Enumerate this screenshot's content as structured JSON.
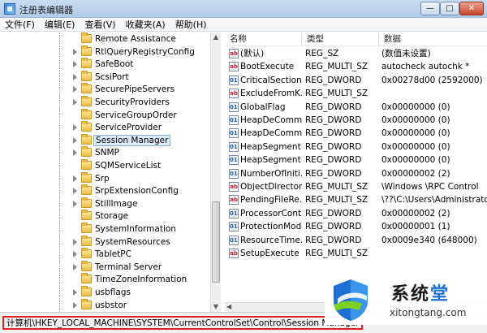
{
  "window": {
    "title": "注册表编辑器",
    "min_label": "—",
    "max_label": "□",
    "close_label": "✕"
  },
  "menu": [
    "文件(F)",
    "编辑(E)",
    "查看(V)",
    "收藏夹(A)",
    "帮助(H)"
  ],
  "tree": {
    "items": [
      {
        "label": "Remote Assistance",
        "expanded_arrow": false
      },
      {
        "label": "RtlQueryRegistryConfig",
        "expanded_arrow": true
      },
      {
        "label": "SafeBoot",
        "expanded_arrow": true
      },
      {
        "label": "ScsiPort",
        "expanded_arrow": true
      },
      {
        "label": "SecurePipeServers",
        "expanded_arrow": true
      },
      {
        "label": "SecurityProviders",
        "expanded_arrow": true
      },
      {
        "label": "ServiceGroupOrder",
        "expanded_arrow": false
      },
      {
        "label": "ServiceProvider",
        "expanded_arrow": true
      },
      {
        "label": "Session Manager",
        "expanded_arrow": true,
        "selected": true
      },
      {
        "label": "SNMP",
        "expanded_arrow": true
      },
      {
        "label": "SQMServiceList",
        "expanded_arrow": false
      },
      {
        "label": "Srp",
        "expanded_arrow": true
      },
      {
        "label": "SrpExtensionConfig",
        "expanded_arrow": true
      },
      {
        "label": "StillImage",
        "expanded_arrow": true
      },
      {
        "label": "Storage",
        "expanded_arrow": false
      },
      {
        "label": "SystemInformation",
        "expanded_arrow": false
      },
      {
        "label": "SystemResources",
        "expanded_arrow": true
      },
      {
        "label": "TabletPC",
        "expanded_arrow": true
      },
      {
        "label": "Terminal Server",
        "expanded_arrow": true
      },
      {
        "label": "TimeZoneInformation",
        "expanded_arrow": false
      },
      {
        "label": "usbflags",
        "expanded_arrow": true
      },
      {
        "label": "usbstor",
        "expanded_arrow": true
      }
    ]
  },
  "values": {
    "headers": {
      "name": "名称",
      "type": "类型",
      "data": "数据"
    },
    "rows": [
      {
        "icon": "string-value-icon",
        "icon_glyph": "ab",
        "name": "(默认)",
        "type": "REG_SZ",
        "data": "(数值未设置)"
      },
      {
        "icon": "string-value-icon",
        "icon_glyph": "ab",
        "name": "BootExecute",
        "type": "REG_MULTI_SZ",
        "data": "autocheck autochk *"
      },
      {
        "icon": "binary-value-icon",
        "icon_glyph": "011",
        "name": "CriticalSection...",
        "type": "REG_DWORD",
        "data": "0x00278d00 (2592000)"
      },
      {
        "icon": "string-value-icon",
        "icon_glyph": "ab",
        "name": "ExcludeFromK...",
        "type": "REG_MULTI_SZ",
        "data": ""
      },
      {
        "icon": "binary-value-icon",
        "icon_glyph": "011",
        "name": "GlobalFlag",
        "type": "REG_DWORD",
        "data": "0x00000000 (0)"
      },
      {
        "icon": "binary-value-icon",
        "icon_glyph": "011",
        "name": "HeapDeComm...",
        "type": "REG_DWORD",
        "data": "0x00000000 (0)"
      },
      {
        "icon": "binary-value-icon",
        "icon_glyph": "011",
        "name": "HeapDeComm...",
        "type": "REG_DWORD",
        "data": "0x00000000 (0)"
      },
      {
        "icon": "binary-value-icon",
        "icon_glyph": "011",
        "name": "HeapSegment...",
        "type": "REG_DWORD",
        "data": "0x00000000 (0)"
      },
      {
        "icon": "binary-value-icon",
        "icon_glyph": "011",
        "name": "HeapSegment...",
        "type": "REG_DWORD",
        "data": "0x00000000 (0)"
      },
      {
        "icon": "binary-value-icon",
        "icon_glyph": "011",
        "name": "NumberOfIniti...",
        "type": "REG_DWORD",
        "data": "0x00000002 (2)"
      },
      {
        "icon": "string-value-icon",
        "icon_glyph": "ab",
        "name": "ObjectDirector...",
        "type": "REG_MULTI_SZ",
        "data": "\\Windows \\RPC Control"
      },
      {
        "icon": "string-value-icon",
        "icon_glyph": "ab",
        "name": "PendingFileRe...",
        "type": "REG_MULTI_SZ",
        "data": "\\??\\C:\\Users\\Administrator"
      },
      {
        "icon": "binary-value-icon",
        "icon_glyph": "011",
        "name": "ProcessorCont...",
        "type": "REG_DWORD",
        "data": "0x00000002 (2)"
      },
      {
        "icon": "binary-value-icon",
        "icon_glyph": "011",
        "name": "ProtectionMode",
        "type": "REG_DWORD",
        "data": "0x00000001 (1)"
      },
      {
        "icon": "binary-value-icon",
        "icon_glyph": "011",
        "name": "ResourceTime...",
        "type": "REG_DWORD",
        "data": "0x0009e340 (648000)"
      },
      {
        "icon": "string-value-icon",
        "icon_glyph": "ab",
        "name": "SetupExecute",
        "type": "REG_MULTI_SZ",
        "data": ""
      }
    ]
  },
  "statusbar": {
    "path": "计算机\\HKEY_LOCAL_MACHINE\\SYSTEM\\CurrentControlSet\\Control\\Session Manager"
  },
  "watermark": {
    "title_main": "系统",
    "title_accent": "堂",
    "url": "xitongtang.com"
  }
}
